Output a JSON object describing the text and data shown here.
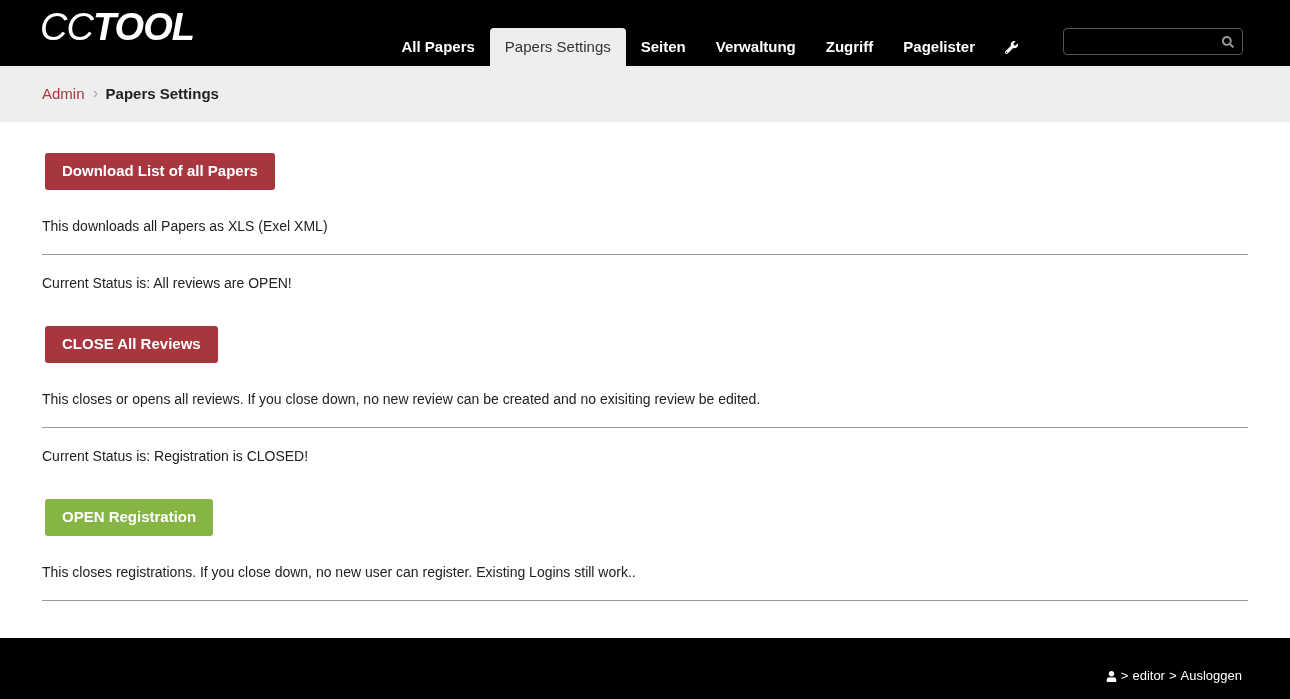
{
  "logo": "CC**TOOL**",
  "nav": [
    {
      "label": "All Papers",
      "selected": false
    },
    {
      "label": "Papers Settings",
      "selected": true
    },
    {
      "label": "Seiten",
      "selected": false
    },
    {
      "label": "Verwaltung",
      "selected": false
    },
    {
      "label": "Zugriff",
      "selected": false
    },
    {
      "label": "Pagelister",
      "selected": false
    }
  ],
  "breadcrumb": {
    "link": "Admin",
    "current": "Papers Settings"
  },
  "sections": [
    {
      "button": {
        "label": "Download List of all Papers",
        "kind": "danger"
      },
      "description": "This downloads all Papers as XLS (Exel XML)"
    },
    {
      "status": "Current Status is: All reviews are OPEN!",
      "button": {
        "label": "CLOSE All Reviews",
        "kind": "danger"
      },
      "description": "This closes or opens all reviews. If you close down, no new review can be created and no exisiting review be edited."
    },
    {
      "status": "Current Status is: Registration is CLOSED!",
      "button": {
        "label": "OPEN Registration",
        "kind": "success"
      },
      "description": "This closes registrations. If you close down, no new user can register. Existing Logins still work.."
    }
  ],
  "footer": {
    "sep1": ">",
    "user": "editor",
    "sep2": ">",
    "logout": "Ausloggen"
  }
}
